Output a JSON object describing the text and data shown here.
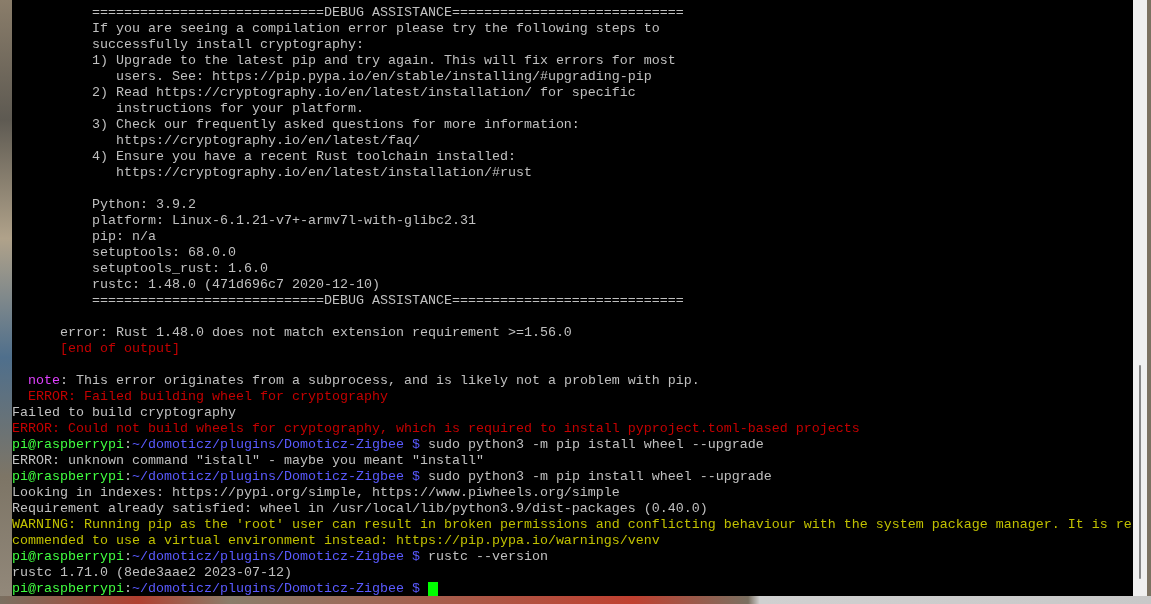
{
  "terminal": {
    "lines": [
      {
        "kind": "text",
        "segments": [
          {
            "kind": "plain",
            "text": "          =============================DEBUG ASSISTANCE============================="
          }
        ]
      },
      {
        "kind": "text",
        "segments": [
          {
            "kind": "plain",
            "text": "          If you are seeing a compilation error please try the following steps to"
          }
        ]
      },
      {
        "kind": "text",
        "segments": [
          {
            "kind": "plain",
            "text": "          successfully install cryptography:"
          }
        ]
      },
      {
        "kind": "text",
        "segments": [
          {
            "kind": "plain",
            "text": "          1) Upgrade to the latest pip and try again. This will fix errors for most"
          }
        ]
      },
      {
        "kind": "text",
        "segments": [
          {
            "kind": "plain",
            "text": "             users. See: https://pip.pypa.io/en/stable/installing/#upgrading-pip"
          }
        ]
      },
      {
        "kind": "text",
        "segments": [
          {
            "kind": "plain",
            "text": "          2) Read https://cryptography.io/en/latest/installation/ for specific"
          }
        ]
      },
      {
        "kind": "text",
        "segments": [
          {
            "kind": "plain",
            "text": "             instructions for your platform."
          }
        ]
      },
      {
        "kind": "text",
        "segments": [
          {
            "kind": "plain",
            "text": "          3) Check our frequently asked questions for more information:"
          }
        ]
      },
      {
        "kind": "text",
        "segments": [
          {
            "kind": "plain",
            "text": "             https://cryptography.io/en/latest/faq/"
          }
        ]
      },
      {
        "kind": "text",
        "segments": [
          {
            "kind": "plain",
            "text": "          4) Ensure you have a recent Rust toolchain installed:"
          }
        ]
      },
      {
        "kind": "text",
        "segments": [
          {
            "kind": "plain",
            "text": "             https://cryptography.io/en/latest/installation/#rust"
          }
        ]
      },
      {
        "kind": "blank"
      },
      {
        "kind": "text",
        "segments": [
          {
            "kind": "plain",
            "text": "          Python: 3.9.2"
          }
        ]
      },
      {
        "kind": "text",
        "segments": [
          {
            "kind": "plain",
            "text": "          platform: Linux-6.1.21-v7+-armv7l-with-glibc2.31"
          }
        ]
      },
      {
        "kind": "text",
        "segments": [
          {
            "kind": "plain",
            "text": "          pip: n/a"
          }
        ]
      },
      {
        "kind": "text",
        "segments": [
          {
            "kind": "plain",
            "text": "          setuptools: 68.0.0"
          }
        ]
      },
      {
        "kind": "text",
        "segments": [
          {
            "kind": "plain",
            "text": "          setuptools_rust: 1.6.0"
          }
        ]
      },
      {
        "kind": "text",
        "segments": [
          {
            "kind": "plain",
            "text": "          rustc: 1.48.0 (471d696c7 2020-12-10)"
          }
        ]
      },
      {
        "kind": "text",
        "segments": [
          {
            "kind": "plain",
            "text": "          =============================DEBUG ASSISTANCE============================="
          }
        ]
      },
      {
        "kind": "blank"
      },
      {
        "kind": "text",
        "segments": [
          {
            "kind": "plain",
            "text": "      error: Rust 1.48.0 does not match extension requirement >=1.56.0"
          }
        ]
      },
      {
        "kind": "text",
        "segments": [
          {
            "kind": "error",
            "text": "      [end of output]"
          }
        ]
      },
      {
        "kind": "blank"
      },
      {
        "kind": "text",
        "segments": [
          {
            "kind": "note",
            "text": "  note"
          },
          {
            "kind": "plain",
            "text": ": This error originates from a subprocess, and is likely not a problem with pip."
          }
        ]
      },
      {
        "kind": "text",
        "segments": [
          {
            "kind": "error",
            "text": "  ERROR: Failed building wheel for cryptography"
          }
        ]
      },
      {
        "kind": "text",
        "segments": [
          {
            "kind": "plain",
            "text": "Failed to build cryptography"
          }
        ]
      },
      {
        "kind": "text",
        "segments": [
          {
            "kind": "error",
            "text": "ERROR: Could not build wheels for cryptography, which is required to install pyproject.toml-based projects"
          }
        ]
      },
      {
        "kind": "text",
        "segments": [
          {
            "kind": "user",
            "text": "pi@raspberrypi"
          },
          {
            "kind": "plain",
            "text": ":"
          },
          {
            "kind": "path",
            "text": "~/domoticz/plugins/Domoticz-Zigbee $"
          },
          {
            "kind": "plain",
            "text": " sudo python3 -m pip istall wheel --upgrade"
          }
        ]
      },
      {
        "kind": "text",
        "segments": [
          {
            "kind": "plain",
            "text": "ERROR: unknown command \"istall\" - maybe you meant \"install\""
          }
        ]
      },
      {
        "kind": "text",
        "segments": [
          {
            "kind": "user",
            "text": "pi@raspberrypi"
          },
          {
            "kind": "plain",
            "text": ":"
          },
          {
            "kind": "path",
            "text": "~/domoticz/plugins/Domoticz-Zigbee $"
          },
          {
            "kind": "plain",
            "text": " sudo python3 -m pip install wheel --upgrade"
          }
        ]
      },
      {
        "kind": "text",
        "segments": [
          {
            "kind": "plain",
            "text": "Looking in indexes: https://pypi.org/simple, https://www.piwheels.org/simple"
          }
        ]
      },
      {
        "kind": "text",
        "segments": [
          {
            "kind": "plain",
            "text": "Requirement already satisfied: wheel in /usr/local/lib/python3.9/dist-packages (0.40.0)"
          }
        ]
      },
      {
        "kind": "text",
        "segments": [
          {
            "kind": "warning",
            "text": "WARNING: Running pip as the 'root' user can result in broken permissions and conflicting behaviour with the system package manager. It is re"
          }
        ]
      },
      {
        "kind": "text",
        "segments": [
          {
            "kind": "warning",
            "text": "commended to use a virtual environment instead: https://pip.pypa.io/warnings/venv"
          }
        ]
      },
      {
        "kind": "text",
        "segments": [
          {
            "kind": "user",
            "text": "pi@raspberrypi"
          },
          {
            "kind": "plain",
            "text": ":"
          },
          {
            "kind": "path",
            "text": "~/domoticz/plugins/Domoticz-Zigbee $"
          },
          {
            "kind": "plain",
            "text": " rustc --version"
          }
        ]
      },
      {
        "kind": "text",
        "segments": [
          {
            "kind": "plain",
            "text": "rustc 1.71.0 (8ede3aae2 2023-07-12)"
          }
        ]
      },
      {
        "kind": "prompt",
        "segments": [
          {
            "kind": "user",
            "text": "pi@raspberrypi"
          },
          {
            "kind": "plain",
            "text": ":"
          },
          {
            "kind": "path",
            "text": "~/domoticz/plugins/Domoticz-Zigbee $"
          }
        ]
      }
    ]
  }
}
